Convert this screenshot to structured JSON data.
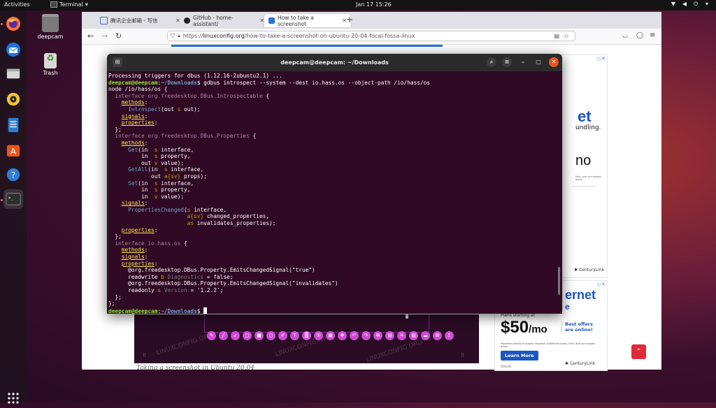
{
  "topbar": {
    "activities": "Activities",
    "app_name": "Terminal",
    "clock": "Jan 17  15:26"
  },
  "desktop": {
    "icons": [
      {
        "label": "deepcam"
      },
      {
        "label": "Trash"
      }
    ]
  },
  "browser": {
    "tabs": [
      {
        "label": "腾讯企业邮箱 - 写信"
      },
      {
        "label": "GitHub - home-assistant/"
      },
      {
        "label": "How to take a screenshot"
      }
    ],
    "url_prefix": "https://",
    "url_host": "linuxconfig.org",
    "url_path": "/how-to-take-a-screenshot-on-ubuntu-20-04-focal-fossa-linux",
    "ads": {
      "top_big1": "et",
      "top_text1": "undling.",
      "top_big2": "no",
      "top_fine": "fees, and surcharges apply.",
      "top_brand": "CenturyLink",
      "bot_big1": "ernet",
      "bot_big2": "e",
      "bot_plans": "Plans starting at",
      "bot_price": "$50",
      "bot_permo": "/mo",
      "bot_offers": "Best offers are online!",
      "bot_fine": "Paperless billing or prepay required. Additional taxes, fees, and surcharges apply.",
      "bot_learn": "Learn More",
      "bot_brand": "CenturyLink",
      "bot_details": "Details"
    },
    "caption": "Taking a screenshot in Ubuntu 20.04",
    "watermark": "LINUXCONFIG.ORG"
  },
  "terminal": {
    "title": "deepcam@deepcam: ~/Downloads",
    "user": "deepcam@deepcam",
    "path": "~/Downloads",
    "line0": "Processing triggers for dbus (1.12.16-2ubuntu2.1) ...",
    "command": "gdbus introspect --system --dest io.hass.os --object-path /io/hass/os",
    "node": "node /io/hass/os {",
    "iface1": "org.freedesktop.DBus.Introspectable",
    "iface2": "org.freedesktop.DBus.Properties",
    "iface3": "io.hass.os",
    "introspect": "Introspect",
    "get": "Get",
    "getall": "GetAll",
    "set": "Set",
    "propchanged": "PropertiesChanged",
    "emits_true": "@org.freedesktop.DBus.Property.EmitsChangedSignal(\"true\")",
    "emits_inval": "@org.freedesktop.DBus.Property.EmitsChangedSignal(\"invalidates\")",
    "diag": "Diagnostics",
    "version": "Version",
    "version_val": "'1.2.2'"
  }
}
